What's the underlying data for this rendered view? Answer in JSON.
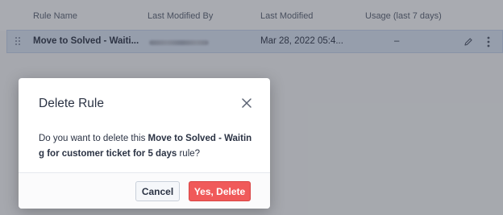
{
  "table": {
    "headers": {
      "rule_name": "Rule Name",
      "last_modified_by": "Last Modified By",
      "last_modified": "Last Modified",
      "usage": "Usage (last 7 days)"
    },
    "rows": [
      {
        "rule_name": "Move to Solved - Waiti...",
        "last_modified": "Mar 28, 2022 05:4...",
        "usage": "–"
      }
    ]
  },
  "dialog": {
    "title": "Delete Rule",
    "message_prefix": "Do you want to delete this ",
    "rule_name": "Move to Solved - Waiting for customer ticket for 5 days",
    "message_suffix": " rule?",
    "cancel_label": "Cancel",
    "confirm_label": "Yes, Delete"
  },
  "colors": {
    "confirm_button": "#f05a5a",
    "selected_row": "#dfe9f7",
    "overlay": "rgba(50,56,68,0.42)"
  }
}
